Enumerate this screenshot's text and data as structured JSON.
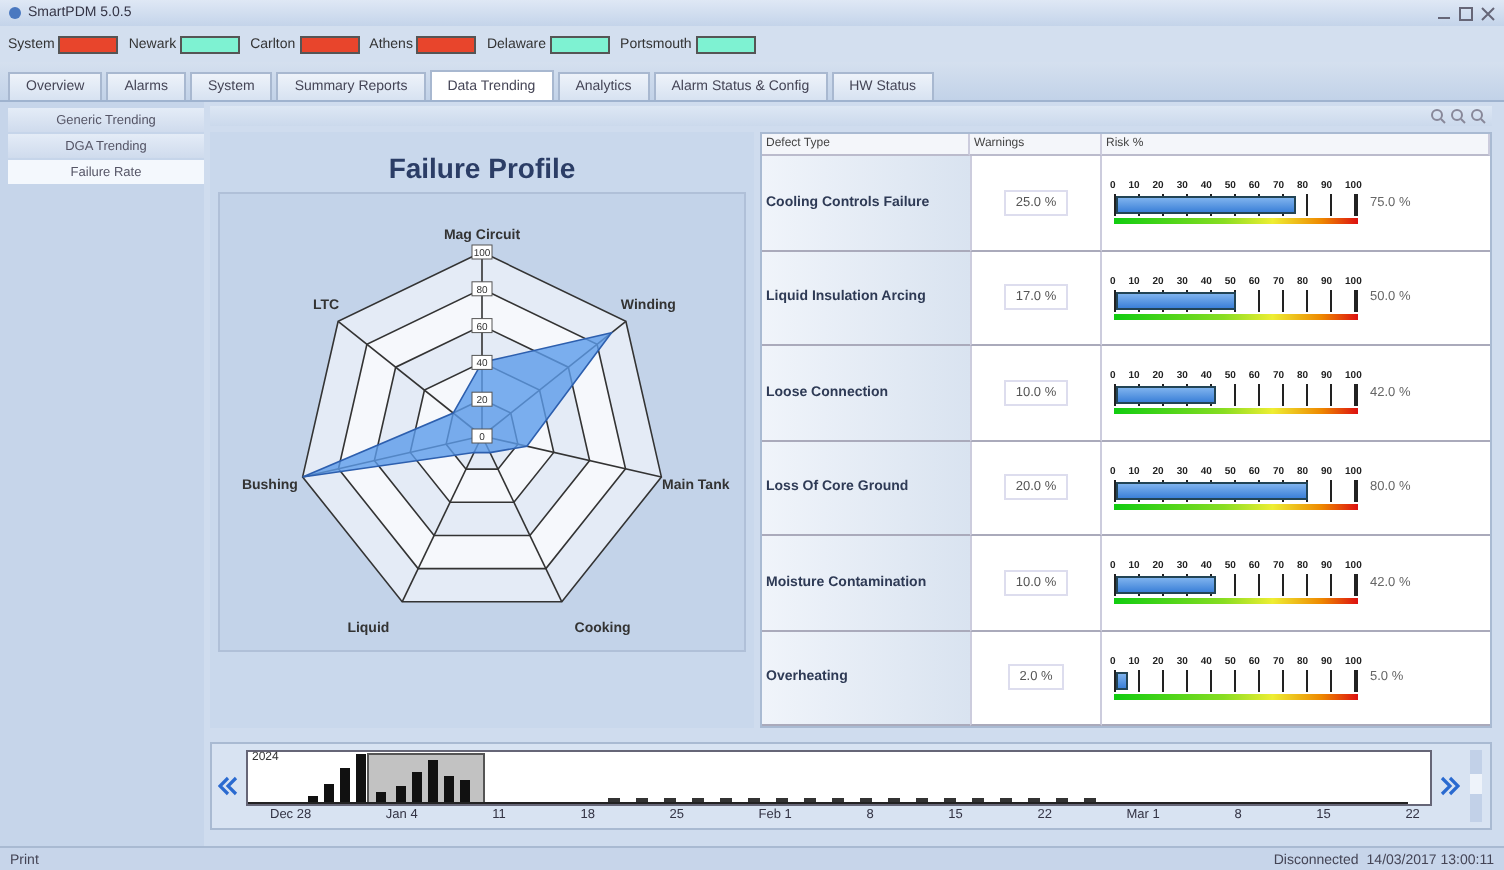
{
  "window": {
    "title": "SmartPDM 5.0.5"
  },
  "sites": [
    {
      "name": "System",
      "color": "#e8452c"
    },
    {
      "name": "Newark",
      "color": "#7ef2d2"
    },
    {
      "name": "Carlton",
      "color": "#e8452c"
    },
    {
      "name": "Athens",
      "color": "#e8452c"
    },
    {
      "name": "Delaware",
      "color": "#7ef2d2"
    },
    {
      "name": "Portsmouth",
      "color": "#7ef2d2"
    }
  ],
  "tabs": [
    {
      "label": "Overview",
      "selected": false
    },
    {
      "label": "Alarms",
      "selected": false
    },
    {
      "label": "System",
      "selected": false
    },
    {
      "label": "Summary Reports",
      "selected": false
    },
    {
      "label": "Data Trending",
      "selected": true
    },
    {
      "label": "Analytics",
      "selected": false
    },
    {
      "label": "Alarm Status & Config",
      "selected": false
    },
    {
      "label": "HW Status",
      "selected": false
    }
  ],
  "sidebar": {
    "items": [
      {
        "label": "Generic Trending",
        "selected": false
      },
      {
        "label": "DGA Trending",
        "selected": false
      },
      {
        "label": "Failure Rate",
        "selected": true
      }
    ]
  },
  "failure_profile": {
    "title": "Failure Profile",
    "axes": [
      "Mag Circuit",
      "Winding",
      "Main Tank",
      "Cooking",
      "Liquid",
      "Bushing",
      "LTC"
    ],
    "ring_labels": [
      "100",
      "80",
      "60",
      "40",
      "20",
      "0"
    ]
  },
  "defects": {
    "columns": [
      "Defect Type",
      "Warnings",
      "Risk %"
    ],
    "rows": [
      {
        "name": "Cooling Controls Failure",
        "warnings": "25.0 %",
        "scale": [
          "0",
          "10",
          "20",
          "30",
          "40",
          "50",
          "60",
          "70",
          "80",
          "90",
          "100"
        ],
        "level": 0.75,
        "reading": "75.0 %"
      },
      {
        "name": "Liquid Insulation Arcing",
        "warnings": "17.0 %",
        "scale": [
          "0",
          "10",
          "20",
          "30",
          "40",
          "50",
          "60",
          "70",
          "80",
          "90",
          "100"
        ],
        "level": 0.5,
        "reading": "50.0 %"
      },
      {
        "name": "Loose Connection",
        "warnings": "10.0 %",
        "scale": [
          "0",
          "10",
          "20",
          "30",
          "40",
          "50",
          "60",
          "70",
          "80",
          "90",
          "100"
        ],
        "level": 0.42,
        "reading": "42.0 %"
      },
      {
        "name": "Loss Of Core Ground",
        "warnings": "20.0 %",
        "scale": [
          "0",
          "10",
          "20",
          "30",
          "40",
          "50",
          "60",
          "70",
          "80",
          "90",
          "100"
        ],
        "level": 0.8,
        "reading": "80.0 %"
      },
      {
        "name": "Moisture Contamination",
        "warnings": "10.0 %",
        "scale": [
          "0",
          "10",
          "20",
          "30",
          "40",
          "50",
          "60",
          "70",
          "80",
          "90",
          "100"
        ],
        "level": 0.42,
        "reading": "42.0 %"
      },
      {
        "name": "Overheating",
        "warnings": "2.0 %",
        "scale": [
          "0",
          "10",
          "20",
          "30",
          "40",
          "50",
          "60",
          "70",
          "80",
          "90",
          "100"
        ],
        "level": 0.05,
        "reading": "5.0 %"
      }
    ]
  },
  "timeline": {
    "year": "2024",
    "dates": [
      "Dec 28",
      "Jan 4",
      "11",
      "18",
      "25",
      "Feb 1",
      "8",
      "15",
      "22",
      "Mar 1",
      "8",
      "15",
      "22"
    ]
  },
  "status_bar": {
    "left": "Print",
    "connection": "Disconnected",
    "timestamp": "14/03/2017 13:00:11"
  }
}
